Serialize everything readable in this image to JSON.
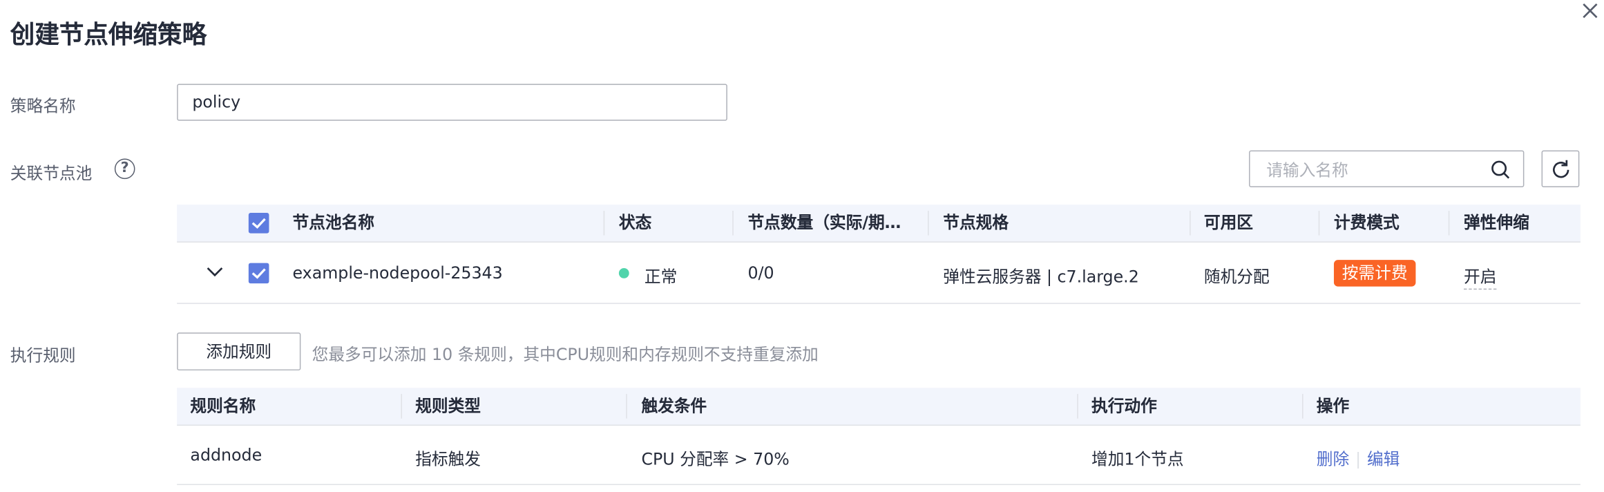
{
  "dialog": {
    "title": "创建节点伸缩策略"
  },
  "form": {
    "policy_name_label": "策略名称",
    "policy_name_value": "policy",
    "nodepool_label": "关联节点池",
    "help_glyph": "?",
    "rules_label": "执行规则"
  },
  "search": {
    "placeholder": "请输入名称"
  },
  "nodepool_table": {
    "headers": [
      "节点池名称",
      "状态",
      "节点数量（实际/期…",
      "节点规格",
      "可用区",
      "计费模式",
      "弹性伸缩"
    ],
    "rows": [
      {
        "name": "example-nodepool-25343",
        "status": "正常",
        "nodes": "0/0",
        "spec": "弹性云服务器 | c7.large.2",
        "zone": "随机分配",
        "billing": "按需计费",
        "autoscaling": "开启"
      }
    ]
  },
  "rules": {
    "add_button": "添加规则",
    "hint": "您最多可以添加 10 条规则，其中CPU规则和内存规则不支持重复添加"
  },
  "rules_table": {
    "headers": [
      "规则名称",
      "规则类型",
      "触发条件",
      "执行动作",
      "操作"
    ],
    "rows": [
      {
        "name": "addnode",
        "type": "指标触发",
        "condition": "CPU 分配率 > 70%",
        "action": "增加1个节点",
        "op_delete": "删除",
        "op_edit": "编辑"
      }
    ]
  },
  "colors": {
    "accent": "#5e7ce0",
    "status_ok": "#50d4ab",
    "billing_badge": "#fa6425",
    "link": "#526ecc"
  }
}
